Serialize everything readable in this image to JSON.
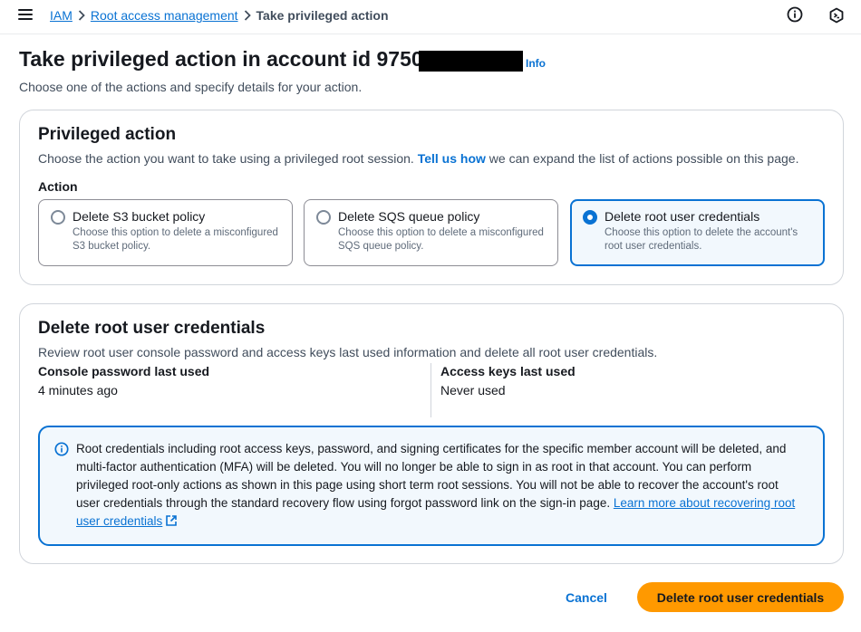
{
  "breadcrumb": {
    "items": [
      "IAM",
      "Root access management"
    ],
    "current": "Take privileged action"
  },
  "header": {
    "title": "Take privileged action in account id 9750",
    "info": "Info",
    "description": "Choose one of the actions and specify details for your action."
  },
  "privileged_action": {
    "title": "Privileged action",
    "description_before": "Choose the action you want to take using a privileged root session. ",
    "description_link": "Tell us how",
    "description_after": " we can expand the list of actions possible on this page.",
    "field_label": "Action",
    "options": [
      {
        "label": "Delete S3 bucket policy",
        "description": "Choose this option to delete a misconfigured S3 bucket policy.",
        "selected": false
      },
      {
        "label": "Delete SQS queue policy",
        "description": "Choose this option to delete a misconfigured SQS queue policy.",
        "selected": false
      },
      {
        "label": "Delete root user credentials",
        "description": "Choose this option to delete the account's root user credentials.",
        "selected": true
      }
    ]
  },
  "delete_credentials": {
    "title": "Delete root user credentials",
    "description": "Review root user console password and access keys last used information and delete all root user credentials.",
    "console_password_label": "Console password last used",
    "console_password_value": "4 minutes ago",
    "access_keys_label": "Access keys last used",
    "access_keys_value": "Never used",
    "alert_text": "Root credentials including root access keys, password, and signing certificates for the specific member account will be deleted, and multi-factor authentication (MFA) will be deleted. You will no longer be able to sign in as root in that account. You can perform privileged root-only actions as shown in this page using short term root sessions. You will not be able to recover the account's root user credentials through the standard recovery flow using forgot password link on the sign-in page. ",
    "alert_link": "Learn more about recovering root user credentials"
  },
  "footer": {
    "cancel_label": "Cancel",
    "submit_label": "Delete root user credentials"
  },
  "colors": {
    "primary_button": "#ff9900",
    "link": "#0972d3",
    "alert_background": "#f2f8fd"
  },
  "icons": [
    "menu-icon",
    "chevron-right-icon",
    "info-circle-icon",
    "cloudshell-icon",
    "info-icon",
    "external-link-icon"
  ]
}
